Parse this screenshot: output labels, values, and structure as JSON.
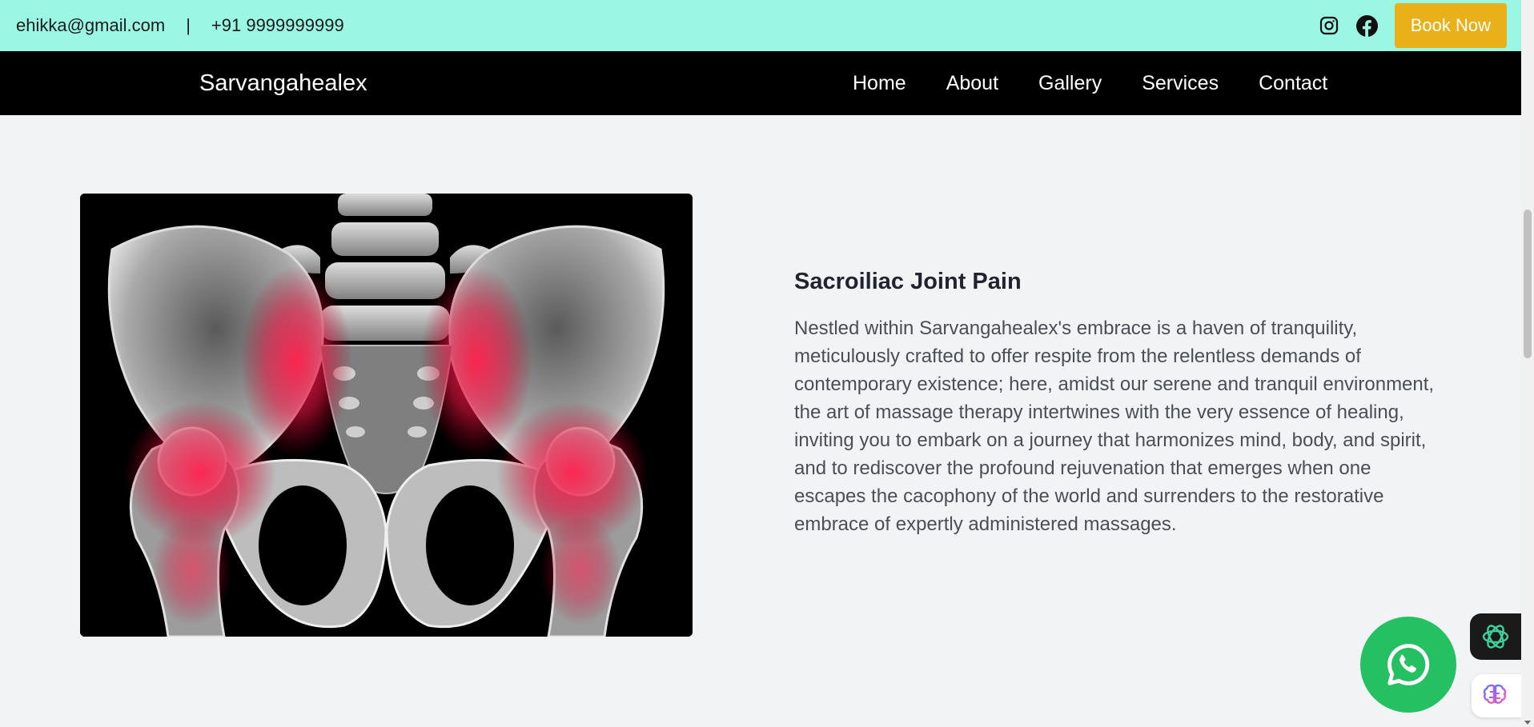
{
  "topbar": {
    "email": "ehikka@gmail.com",
    "separator": "|",
    "phone": "+91 9999999999",
    "book_label": "Book Now",
    "colors": {
      "background": "#9bf6e4",
      "book_button": "#e8b019"
    }
  },
  "navbar": {
    "brand": "Sarvangahealex",
    "links": [
      "Home",
      "About",
      "Gallery",
      "Services",
      "Contact"
    ]
  },
  "main": {
    "image_alt": "X-ray of pelvis and hip joints highlighted in red",
    "title": "Sacroiliac Joint Pain",
    "body": "Nestled within Sarvangahealex's embrace is a haven of tranquility, meticulously crafted to offer respite from the relentless demands of contemporary existence; here, amidst our serene and tranquil environment, the art of massage therapy intertwines with the very essence of healing, inviting you to embark on a journey that harmonizes mind, body, and spirit, and to rediscover the profound rejuvenation that emerges when one escapes the cacophony of the world and surrenders to the restorative embrace of expertly administered massages."
  },
  "icons": {
    "instagram": "instagram-icon",
    "facebook": "facebook-icon",
    "whatsapp": "whatsapp-icon",
    "ai_assistant": "openai-icon",
    "brain": "brain-icon"
  }
}
